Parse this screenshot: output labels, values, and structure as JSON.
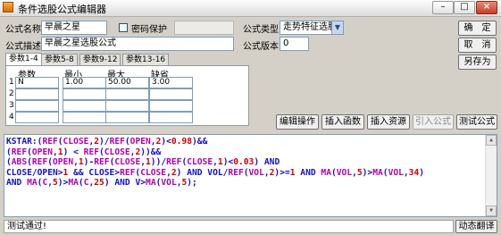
{
  "window": {
    "title": "条件选股公式编辑器",
    "minimize": "–",
    "maximize": "□",
    "close": "×"
  },
  "form": {
    "name_label": "公式名称",
    "name_value": "早晨之星",
    "password_label": "密码保护",
    "desc_label": "公式描述",
    "desc_value": "早晨之星选股公式",
    "type_label": "公式类型",
    "type_value": "走势特征选股",
    "version_label": "公式版本",
    "version_value": "0"
  },
  "buttons": {
    "ok": "确　定",
    "cancel": "取　消",
    "save_as": "另存为",
    "edit_ops": "编辑操作",
    "insert_func": "插入函数",
    "insert_resource": "插入资源",
    "import_formula": "引入公式",
    "test_formula": "测试公式",
    "translate": "动态翻译"
  },
  "param_tabs": [
    "参数1-4",
    "参数5-8",
    "参数9-12",
    "参数13-16"
  ],
  "param_table": {
    "headers": [
      "参数",
      "最小",
      "最大",
      "缺省"
    ],
    "rows": [
      {
        "num": "1",
        "cells": [
          "N",
          "1.00",
          "50.00",
          "3.00"
        ]
      },
      {
        "num": "2",
        "cells": [
          "",
          "",
          "",
          ""
        ]
      },
      {
        "num": "3",
        "cells": [
          "",
          "",
          "",
          ""
        ]
      },
      {
        "num": "4",
        "cells": [
          "",
          "",
          "",
          ""
        ]
      }
    ]
  },
  "code": {
    "lines": [
      [
        [
          "KSTAR:(",
          "blue"
        ],
        [
          "REF",
          "mag"
        ],
        [
          "(",
          "blue"
        ],
        [
          "CLOSE",
          "mag"
        ],
        [
          ",",
          "blue"
        ],
        [
          "2",
          "red"
        ],
        [
          ")/",
          "blue"
        ],
        [
          "REF",
          "mag"
        ],
        [
          "(",
          "blue"
        ],
        [
          "OPEN",
          "mag"
        ],
        [
          ",",
          "blue"
        ],
        [
          "2",
          "red"
        ],
        [
          ")<",
          "blue"
        ],
        [
          "0.98",
          "red"
        ],
        [
          ")&&",
          "blue"
        ]
      ],
      [
        [
          "(",
          "blue"
        ],
        [
          "REF",
          "mag"
        ],
        [
          "(",
          "blue"
        ],
        [
          "OPEN",
          "mag"
        ],
        [
          ",",
          "blue"
        ],
        [
          "1",
          "red"
        ],
        [
          ") < ",
          "blue"
        ],
        [
          "REF",
          "mag"
        ],
        [
          "(",
          "blue"
        ],
        [
          "CLOSE",
          "mag"
        ],
        [
          ",",
          "blue"
        ],
        [
          "2",
          "red"
        ],
        [
          "))&&",
          "blue"
        ]
      ],
      [
        [
          "(",
          "blue"
        ],
        [
          "ABS",
          "mag"
        ],
        [
          "(",
          "blue"
        ],
        [
          "REF",
          "mag"
        ],
        [
          "(",
          "blue"
        ],
        [
          "OPEN",
          "mag"
        ],
        [
          ",",
          "blue"
        ],
        [
          "1",
          "red"
        ],
        [
          ")-",
          "blue"
        ],
        [
          "REF",
          "mag"
        ],
        [
          "(",
          "blue"
        ],
        [
          "CLOSE",
          "mag"
        ],
        [
          ",",
          "blue"
        ],
        [
          "1",
          "red"
        ],
        [
          "))/",
          "blue"
        ],
        [
          "REF",
          "mag"
        ],
        [
          "(",
          "blue"
        ],
        [
          "CLOSE",
          "mag"
        ],
        [
          ",",
          "blue"
        ],
        [
          "1",
          "red"
        ],
        [
          ")<",
          "blue"
        ],
        [
          "0.03",
          "red"
        ],
        [
          ") AND",
          "blue"
        ]
      ],
      [
        [
          "CLOSE/OPEN>",
          "blue"
        ],
        [
          "1",
          "red"
        ],
        [
          " && CLOSE>",
          "blue"
        ],
        [
          "REF",
          "mag"
        ],
        [
          "(",
          "blue"
        ],
        [
          "CLOSE",
          "mag"
        ],
        [
          ",",
          "blue"
        ],
        [
          "2",
          "red"
        ],
        [
          ") AND VOL/",
          "blue"
        ],
        [
          "REF",
          "mag"
        ],
        [
          "(",
          "blue"
        ],
        [
          "VOL",
          "mag"
        ],
        [
          ",",
          "blue"
        ],
        [
          "2",
          "red"
        ],
        [
          ")>=",
          "blue"
        ],
        [
          "1",
          "red"
        ],
        [
          " AND ",
          "blue"
        ],
        [
          "MA",
          "mag"
        ],
        [
          "(",
          "blue"
        ],
        [
          "VOL",
          "mag"
        ],
        [
          ",",
          "blue"
        ],
        [
          "5",
          "red"
        ],
        [
          ")>",
          "blue"
        ],
        [
          "MA",
          "mag"
        ],
        [
          "(",
          "blue"
        ],
        [
          "VOL",
          "mag"
        ],
        [
          ",",
          "blue"
        ],
        [
          "34",
          "red"
        ],
        [
          ")",
          "blue"
        ]
      ],
      [
        [
          "AND ",
          "blue"
        ],
        [
          "MA",
          "mag"
        ],
        [
          "(",
          "blue"
        ],
        [
          "C",
          "mag"
        ],
        [
          ",",
          "blue"
        ],
        [
          "5",
          "red"
        ],
        [
          ")>",
          "blue"
        ],
        [
          "MA",
          "mag"
        ],
        [
          "(",
          "blue"
        ],
        [
          "C",
          "mag"
        ],
        [
          ",",
          "blue"
        ],
        [
          "25",
          "red"
        ],
        [
          ") AND V>",
          "blue"
        ],
        [
          "MA",
          "mag"
        ],
        [
          "(",
          "blue"
        ],
        [
          "VOL",
          "mag"
        ],
        [
          ",",
          "blue"
        ],
        [
          "5",
          "red"
        ],
        [
          ");",
          "blue"
        ]
      ]
    ]
  },
  "status": {
    "message": "测试通过!"
  },
  "colors": {
    "code_blue": "#1010d0",
    "code_red": "#d00000",
    "code_magenta": "#b000b0"
  }
}
